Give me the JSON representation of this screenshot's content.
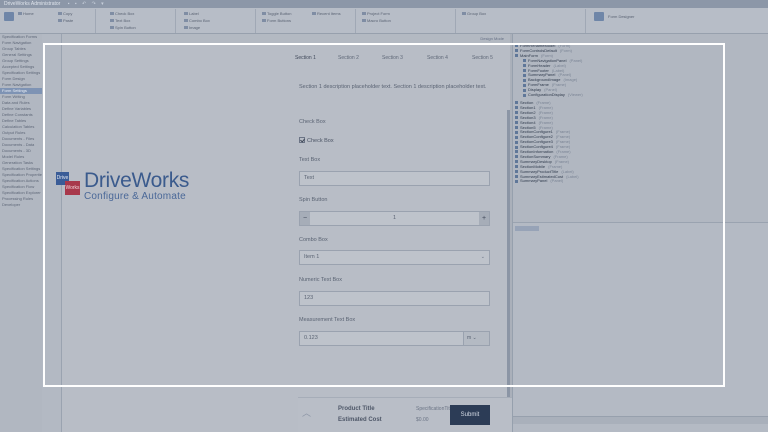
{
  "app": {
    "title": "DriveWorks Administrator",
    "quick_access": "▪ ▪ ↶ ↷ ▾"
  },
  "ribbon": {
    "groups": [
      {
        "label": "Home"
      },
      {
        "label": "Copy"
      },
      {
        "label": "Paste"
      },
      {
        "label": "Check Box"
      },
      {
        "label": "Text Box"
      },
      {
        "label": "Spin Button"
      },
      {
        "label": "Label"
      },
      {
        "label": "Combo Box"
      },
      {
        "label": "Image"
      },
      {
        "label": "Toggle Button"
      },
      {
        "label": "Form Buttons"
      },
      {
        "label": "Recent Items"
      },
      {
        "label": "Project Form"
      },
      {
        "label": "Macro Button"
      },
      {
        "label": "Group Box"
      },
      {
        "label": "Form Designer"
      }
    ]
  },
  "left_tree": {
    "items": [
      "Specification Forms",
      "Form Navigation",
      "Group Tables",
      "General Settings",
      "Group Settings",
      "Accepted Settings",
      "Specification Settings",
      "Form Design",
      "Form Navigation",
      "Form Settings",
      "Form Writing",
      "Data and Rules",
      "Define Variables",
      "Define Constants",
      "Define Tables",
      "Calculation Tables",
      "Output Rules",
      "Documents - Files",
      "Documents - Data",
      "Documents - 3D",
      "Model Rules",
      "Generation Tasks",
      "Specification Settings",
      "Specification Properties",
      "Specification Actions",
      "Specification Flow",
      "Specification Explorer",
      "Processing Rules",
      "Developer"
    ],
    "selected_index": 9
  },
  "stage": {
    "zoom_label": "Design Mode"
  },
  "right_tree": {
    "items": [
      {
        "name": "FormRenameModel",
        "kind": "(Form)"
      },
      {
        "name": "FormControlsDefault",
        "kind": "(Form)"
      },
      {
        "name": "MainForm",
        "kind": "(Form)"
      },
      {
        "name": "FormNavigationPanel",
        "kind": "(Panel)"
      },
      {
        "name": "FormHeader",
        "kind": "(Label)"
      },
      {
        "name": "FormFooter",
        "kind": "(Label)"
      },
      {
        "name": "SummaryPanel",
        "kind": "(Panel)"
      },
      {
        "name": "BackgroundImage",
        "kind": "(Image)"
      },
      {
        "name": "FormFrame",
        "kind": "(Frame)"
      },
      {
        "name": "Display",
        "kind": "(Panel)"
      },
      {
        "name": "ConfigurationDisplay",
        "kind": "(Viewer)"
      },
      {
        "name": "Section",
        "kind": "(Frame)"
      },
      {
        "name": "Section1",
        "kind": "(Frame)"
      },
      {
        "name": "Section2",
        "kind": "(Frame)"
      },
      {
        "name": "Section3",
        "kind": "(Frame)"
      },
      {
        "name": "Section4",
        "kind": "(Frame)"
      },
      {
        "name": "Section5",
        "kind": "(Frame)"
      },
      {
        "name": "SectionConfigure1",
        "kind": "(Frame)"
      },
      {
        "name": "SectionConfigure2",
        "kind": "(Frame)"
      },
      {
        "name": "SectionConfigure3",
        "kind": "(Frame)"
      },
      {
        "name": "SectionConfigure4",
        "kind": "(Frame)"
      },
      {
        "name": "SectionInformation",
        "kind": "(Frame)"
      },
      {
        "name": "SectionSummary",
        "kind": "(Frame)"
      },
      {
        "name": "SummaryDesktop",
        "kind": "(Frame)"
      },
      {
        "name": "SectionMobile",
        "kind": "(Frame)"
      },
      {
        "name": "SummaryProductTitle",
        "kind": "(Label)"
      },
      {
        "name": "SummaryEstimatedCost",
        "kind": "(Label)"
      },
      {
        "name": "SummaryPanel",
        "kind": "(Panel)"
      }
    ]
  },
  "form": {
    "brand_top": "Drive",
    "brand_bottom": "Works",
    "brand_name": "DriveWorks",
    "tagline": "Configure & Automate",
    "tabs": [
      "Section 1",
      "Section 2",
      "Section 3",
      "Section 4",
      "Section 5"
    ],
    "description": "Section 1 description placeholder text. Section 1 description placeholder text.",
    "check_box_label": "Check Box",
    "check_box_text": "Check Box",
    "text_box_label": "Text Box",
    "text_box_value": "Text",
    "spin_label": "Spin Button",
    "spin_value": "1",
    "spin_minus": "−",
    "spin_plus": "+",
    "combo_label": "Combo Box",
    "combo_value": "Item 1",
    "numeric_label": "Numeric Text Box",
    "numeric_value": "123",
    "measure_label": "Measurement Text Box",
    "measure_value": "0.123",
    "measure_unit": "m",
    "footer_product_key": "Product Title",
    "footer_product_val": "SpecificationTitle",
    "footer_cost_key": "Estimated Cost",
    "footer_cost_val": "$0.00",
    "submit_label": "Submit"
  }
}
